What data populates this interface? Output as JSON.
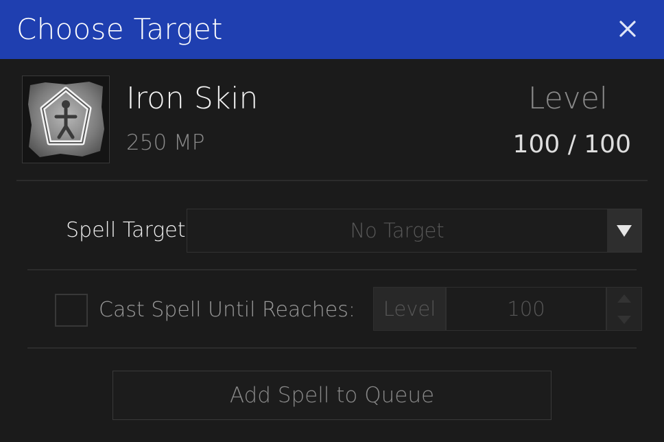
{
  "window": {
    "title": "Choose Target",
    "close_icon": "close-icon"
  },
  "spell": {
    "icon": "iron-skin-spell-icon",
    "name": "Iron Skin",
    "cost": "250 MP",
    "level_label": "Level",
    "level_value": "100 / 100"
  },
  "target": {
    "label": "Spell Target:",
    "selected": "No Target",
    "dropdown_icon": "chevron-down-icon"
  },
  "cast_until": {
    "checked": false,
    "label": "Cast Spell Until Reaches:",
    "unit": "Level",
    "value": "100"
  },
  "actions": {
    "add_label": "Add Spell to Queue"
  },
  "colors": {
    "titlebar": "#1f3fb0",
    "background": "#1b1b1b",
    "text_primary": "#f2f2f2",
    "text_muted": "#8a8a8a",
    "text_disabled": "#575757"
  }
}
